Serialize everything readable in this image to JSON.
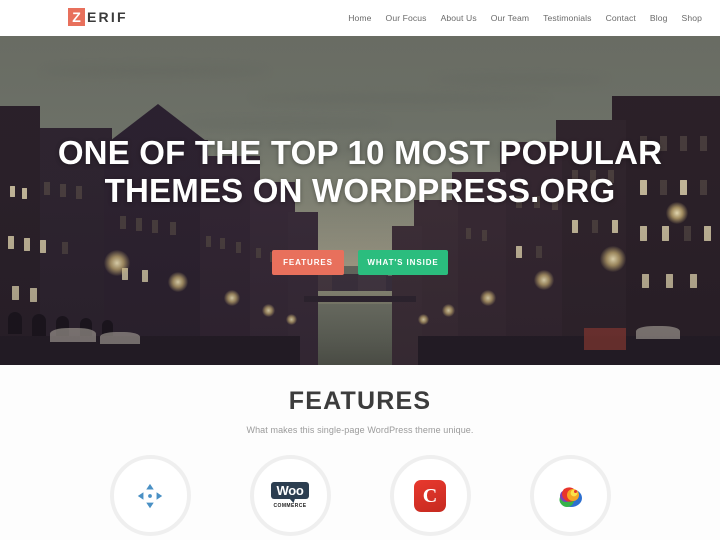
{
  "header": {
    "logo": {
      "accent_letter": "Z",
      "rest": "ERIF",
      "accent_color": "#e8705c"
    },
    "nav": [
      {
        "label": "Home"
      },
      {
        "label": "Our Focus"
      },
      {
        "label": "About Us"
      },
      {
        "label": "Our Team"
      },
      {
        "label": "Testimonials"
      },
      {
        "label": "Contact"
      },
      {
        "label": "Blog"
      },
      {
        "label": "Shop"
      }
    ]
  },
  "hero": {
    "title": "ONE OF THE TOP 10 MOST POPULAR THEMES ON WORDPRESS.ORG",
    "buttons": [
      {
        "label": "FEATURES",
        "color": "#e8705c"
      },
      {
        "label": "WHAT'S INSIDE",
        "color": "#2bbd7e"
      }
    ],
    "background_description": "Dusk photo of a city canal lined with buildings and street lamps"
  },
  "features": {
    "title": "FEATURES",
    "subtitle": "What makes this single-page WordPress theme unique.",
    "items": [
      {
        "icon": "move-arrows-icon",
        "name": "responsive-feature"
      },
      {
        "icon": "woocommerce-logo-icon",
        "woo_top": "Woo",
        "woo_bottom": "COMMERCE",
        "name": "woocommerce-feature"
      },
      {
        "icon": "c-badge-icon",
        "letter": "C",
        "name": "c-badge-feature"
      },
      {
        "icon": "colorful-parrot-icon",
        "name": "parrot-feature"
      }
    ]
  }
}
